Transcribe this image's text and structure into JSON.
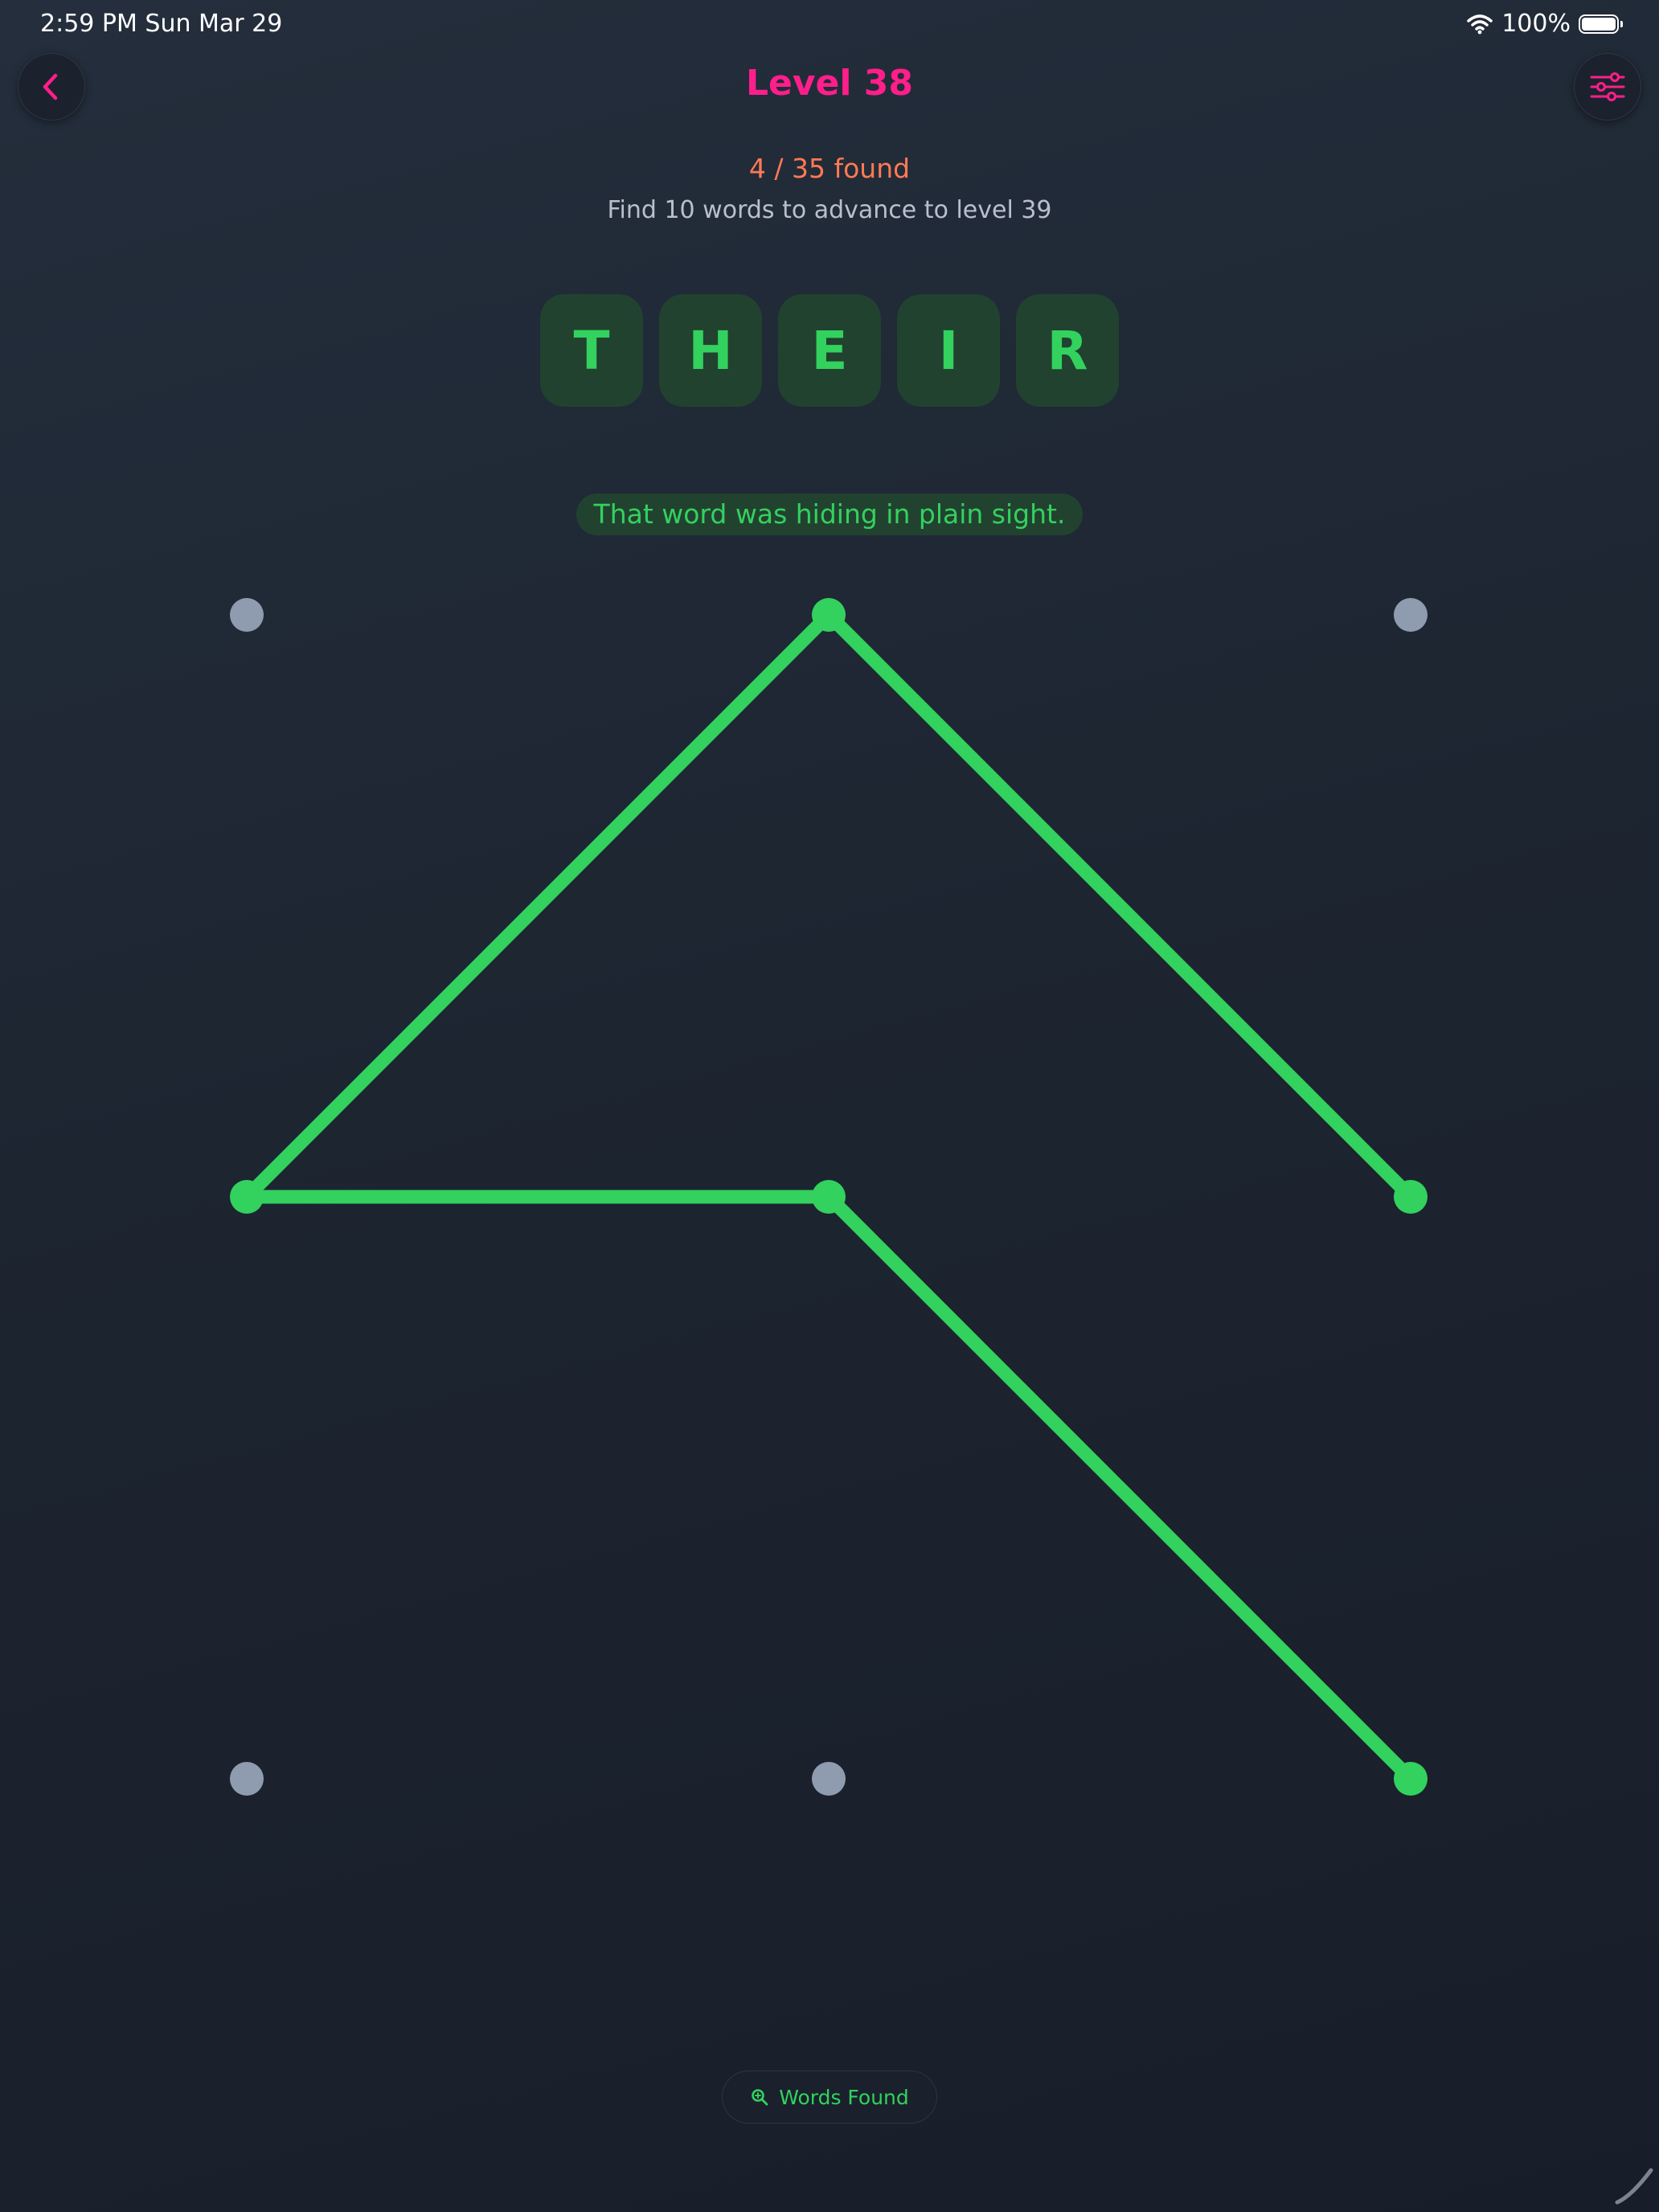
{
  "status_bar": {
    "time_date": "2:59 PM   Sun Mar 29",
    "battery": "100%"
  },
  "header": {
    "title": "Level 38"
  },
  "progress": {
    "found": "4 / 35 found",
    "goal": "Find 10 words to advance to level 39"
  },
  "current_word": [
    "T",
    "H",
    "E",
    "I",
    "R"
  ],
  "feedback": "That word was hiding in plain sight.",
  "colors": {
    "accent": "#ff1e8a",
    "found_count": "#ff7a55",
    "active": "#33d15e",
    "dot_inactive": "#8f9caf"
  },
  "pattern": {
    "dots": [
      {
        "row": 0,
        "col": 0,
        "active": false
      },
      {
        "row": 0,
        "col": 1,
        "active": true
      },
      {
        "row": 0,
        "col": 2,
        "active": false
      },
      {
        "row": 1,
        "col": 0,
        "active": true
      },
      {
        "row": 1,
        "col": 1,
        "active": true
      },
      {
        "row": 1,
        "col": 2,
        "active": true
      },
      {
        "row": 2,
        "col": 0,
        "active": false
      },
      {
        "row": 2,
        "col": 1,
        "active": false
      },
      {
        "row": 2,
        "col": 2,
        "active": true
      }
    ],
    "path": [
      [
        2,
        2
      ],
      [
        1,
        1
      ],
      [
        1,
        0
      ],
      [
        0,
        1
      ],
      [
        1,
        2
      ]
    ]
  },
  "bottom": {
    "words_found_label": "Words Found",
    "icon": "magnifier-icon"
  }
}
